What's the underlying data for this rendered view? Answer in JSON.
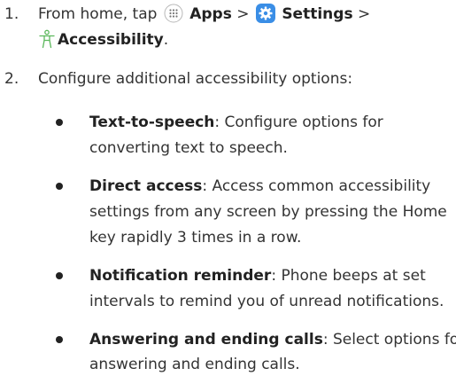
{
  "step1": {
    "number": "1.",
    "prefix": "From home, tap",
    "apps_label": "Apps",
    "sep1": ">",
    "settings_label": "Settings",
    "sep2": ">",
    "accessibility_label": "Accessibility",
    "period": "."
  },
  "step2": {
    "number": "2.",
    "text": "Configure additional accessibility options:"
  },
  "bullets": [
    {
      "term": "Text-to-speech",
      "lines": [
        ": Configure options for",
        "converting text to speech."
      ]
    },
    {
      "term": "Direct access",
      "lines": [
        ": Access common accessibility",
        "settings from any screen by pressing the Home",
        "key rapidly 3 times in a row."
      ]
    },
    {
      "term": "Notification reminder",
      "lines": [
        ": Phone beeps at set",
        "intervals to remind you of unread notifications."
      ]
    },
    {
      "term": "Answering and ending calls",
      "lines": [
        ": Select options for",
        "answering and ending calls."
      ]
    }
  ],
  "icons": {
    "apps": "apps-grid-icon",
    "settings": "gear-icon",
    "accessibility": "accessibility-person-icon"
  },
  "colors": {
    "settings_icon_bg": "#3a8ee6",
    "accessibility_icon": "#5cb85c"
  }
}
